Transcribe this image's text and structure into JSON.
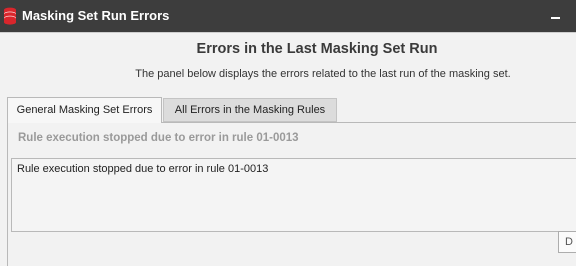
{
  "window": {
    "title": "Masking Set Run Errors",
    "icon": "database-stack-icon"
  },
  "header": {
    "title": "Errors in the Last Masking Set Run",
    "subtitle": "The panel below displays the errors related to the last run of the masking set."
  },
  "tabs": [
    {
      "label": "General Masking Set Errors",
      "active": true
    },
    {
      "label": "All Errors in the Masking Rules",
      "active": false
    }
  ],
  "panel": {
    "status": "Rule execution stopped due to error in rule 01-0013",
    "error_text": "Rule execution stopped due to error in rule 01-0013"
  },
  "footer": {
    "button_label": "D"
  },
  "colors": {
    "titlebar": "#3d3d3d",
    "icon_red": "#d9262c",
    "background": "#f2f2f2"
  }
}
